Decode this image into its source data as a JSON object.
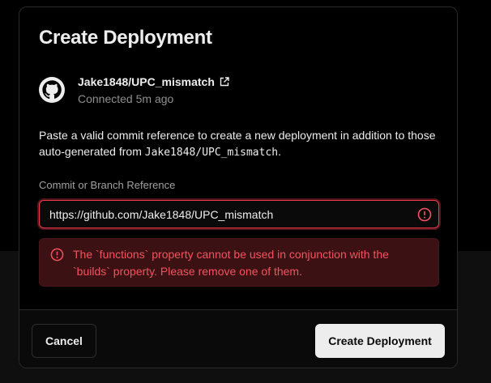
{
  "modal": {
    "title": "Create Deployment"
  },
  "repo": {
    "name": "Jake1848/UPC_mismatch",
    "status": "Connected 5m ago",
    "icon": "github-icon",
    "link_icon": "external-link-icon"
  },
  "description": {
    "text_before": "Paste a valid commit reference to create a new deployment in addition to those auto-generated from ",
    "repo_ref": "Jake1848/UPC_mismatch",
    "text_after": "."
  },
  "field": {
    "label": "Commit or Branch Reference",
    "value": "https://github.com/Jake1848/UPC_mismatch",
    "alert_icon": "alert-circle-icon"
  },
  "error": {
    "icon": "alert-circle-icon",
    "message": "The `functions` property cannot be used in conjunction with the `builds` property. Please remove one of them."
  },
  "footer": {
    "cancel_label": "Cancel",
    "create_label": "Create Deployment"
  },
  "colors": {
    "error": "#f2535f",
    "error_bg": "#3b1114",
    "input_border_error": "#ea3a4a",
    "primary_button_bg": "#ededed"
  }
}
